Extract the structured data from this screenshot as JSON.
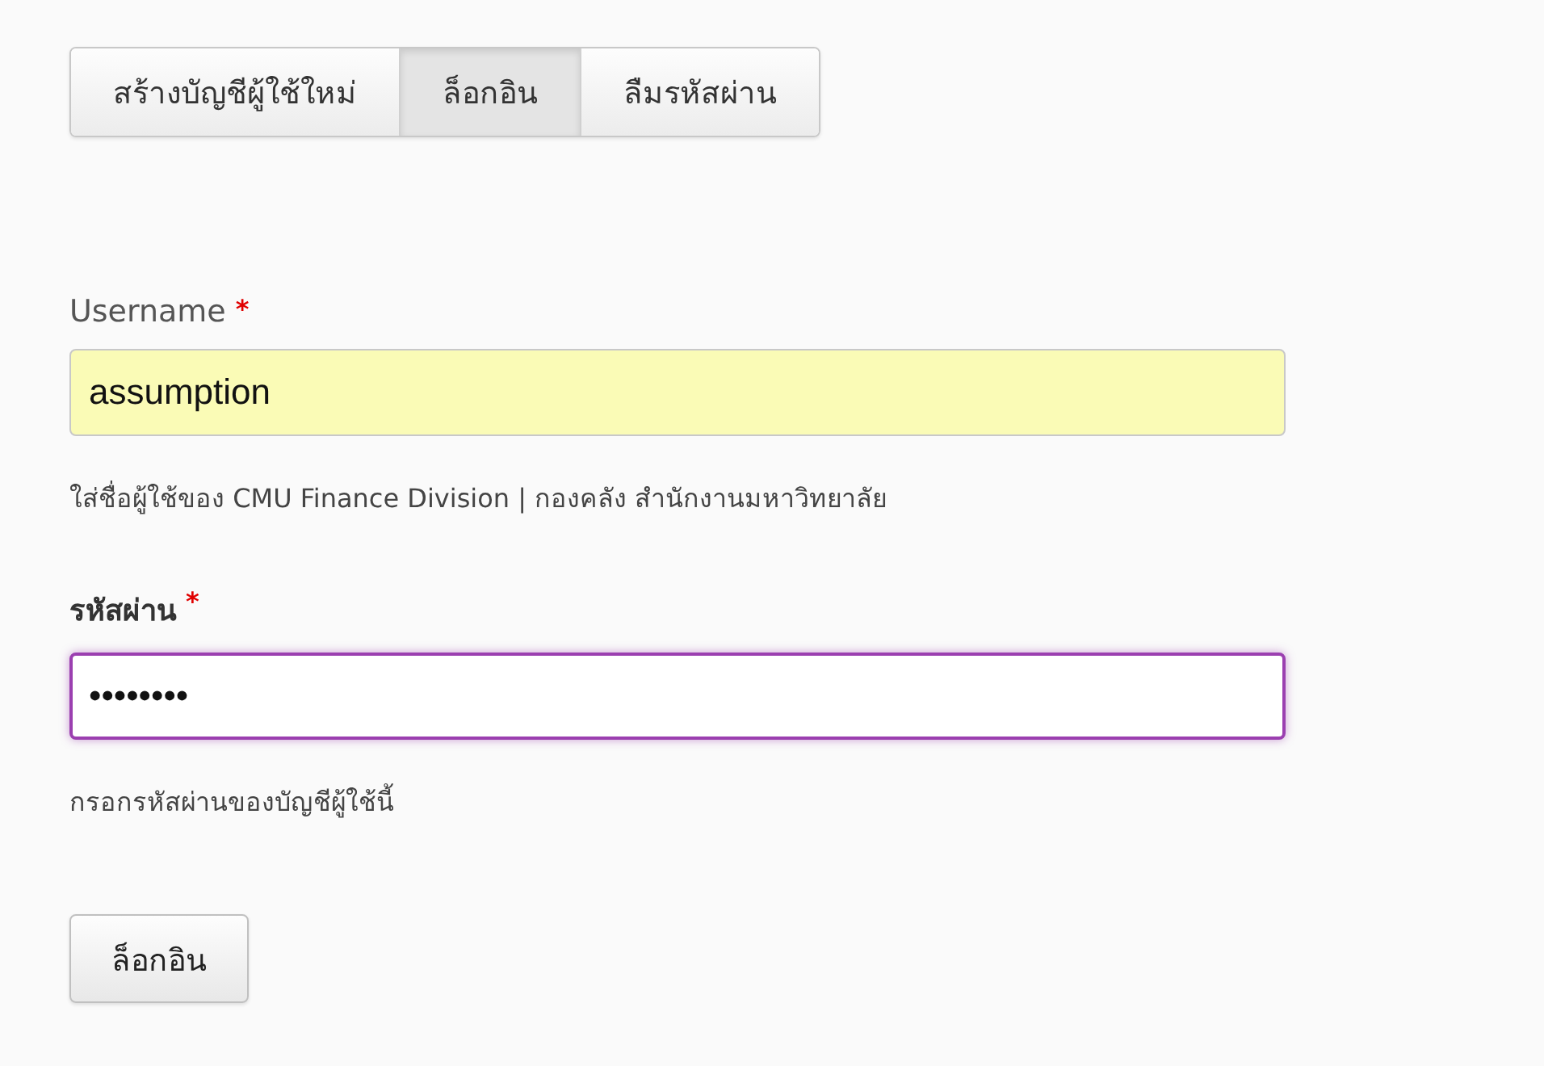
{
  "tabs": [
    {
      "label": "สร้างบัญชีผู้ใช้ใหม่",
      "selected": false
    },
    {
      "label": "ล็อกอิน",
      "selected": true
    },
    {
      "label": "ลืมรหัสผ่าน",
      "selected": false
    }
  ],
  "fields": [
    {
      "label": "Username",
      "required_mark": "*",
      "value": "assumption",
      "autofilled": true,
      "focused": false,
      "bold_label": false,
      "description": "ใส่ชื่อผู้ใช้ของ CMU Finance Division | กองคลัง สำนักงานมหาวิทยาลัย"
    },
    {
      "label": "รหัสผ่าน",
      "required_mark": "*",
      "value": "••••••••",
      "autofilled": false,
      "focused": true,
      "bold_label": true,
      "description": "กรอกรหัสผ่านของบัญชีผู้ใช้นี้"
    }
  ],
  "submit": {
    "label": "ล็อกอิน"
  }
}
